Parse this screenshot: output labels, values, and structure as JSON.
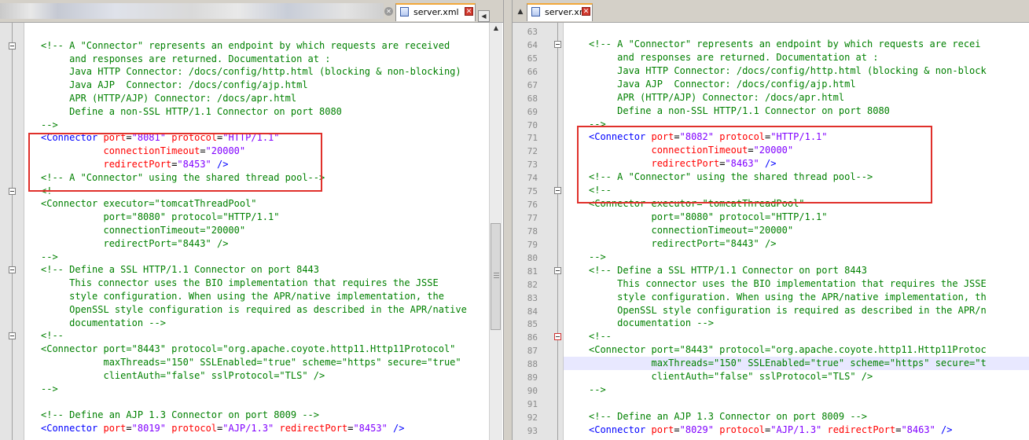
{
  "left_pane": {
    "tab_label": "server.xml",
    "tab_close": "✕",
    "nav_prev": "◀",
    "nav_next": "▶",
    "code": [
      {
        "parts": [
          [
            "c",
            ""
          ]
        ]
      },
      {
        "parts": [
          [
            "c",
            "<!-- A \"Connector\" represents an endpoint by which requests are received"
          ]
        ],
        "fold": true
      },
      {
        "parts": [
          [
            "c",
            "     and responses are returned. Documentation at :"
          ]
        ]
      },
      {
        "parts": [
          [
            "c",
            "     Java HTTP Connector: /docs/config/http.html (blocking & non-blocking)"
          ]
        ]
      },
      {
        "parts": [
          [
            "c",
            "     Java AJP  Connector: /docs/config/ajp.html"
          ]
        ]
      },
      {
        "parts": [
          [
            "c",
            "     APR (HTTP/AJP) Connector: /docs/apr.html"
          ]
        ]
      },
      {
        "parts": [
          [
            "c",
            "     Define a non-SSL HTTP/1.1 Connector on port 8080"
          ]
        ]
      },
      {
        "parts": [
          [
            "c",
            "-->"
          ]
        ]
      },
      {
        "parts": [
          [
            "t",
            "<Connector "
          ],
          [
            "a",
            "port"
          ],
          [
            "p",
            "="
          ],
          [
            "v",
            "\"8081\""
          ],
          [
            "p",
            " "
          ],
          [
            "a",
            "protocol"
          ],
          [
            "p",
            "="
          ],
          [
            "v",
            "\"HTTP/1.1\""
          ]
        ]
      },
      {
        "parts": [
          [
            "p",
            "           "
          ],
          [
            "a",
            "connectionTimeout"
          ],
          [
            "p",
            "="
          ],
          [
            "v",
            "\"20000\""
          ]
        ]
      },
      {
        "parts": [
          [
            "p",
            "           "
          ],
          [
            "a",
            "redirectPort"
          ],
          [
            "p",
            "="
          ],
          [
            "v",
            "\"8453\""
          ],
          [
            "t",
            " />"
          ]
        ]
      },
      {
        "parts": [
          [
            "c",
            "<!-- A \"Connector\" using the shared thread pool-->"
          ]
        ]
      },
      {
        "parts": [
          [
            "c",
            "<!--"
          ]
        ],
        "fold": true
      },
      {
        "parts": [
          [
            "c",
            "<Connector executor=\"tomcatThreadPool\""
          ]
        ]
      },
      {
        "parts": [
          [
            "c",
            "           port=\"8080\" protocol=\"HTTP/1.1\""
          ]
        ]
      },
      {
        "parts": [
          [
            "c",
            "           connectionTimeout=\"20000\""
          ]
        ]
      },
      {
        "parts": [
          [
            "c",
            "           redirectPort=\"8443\" />"
          ]
        ]
      },
      {
        "parts": [
          [
            "c",
            "-->"
          ]
        ]
      },
      {
        "parts": [
          [
            "c",
            "<!-- Define a SSL HTTP/1.1 Connector on port 8443"
          ]
        ],
        "fold": true
      },
      {
        "parts": [
          [
            "c",
            "     This connector uses the BIO implementation that requires the JSSE"
          ]
        ]
      },
      {
        "parts": [
          [
            "c",
            "     style configuration. When using the APR/native implementation, the"
          ]
        ]
      },
      {
        "parts": [
          [
            "c",
            "     OpenSSL style configuration is required as described in the APR/native"
          ]
        ]
      },
      {
        "parts": [
          [
            "c",
            "     documentation -->"
          ]
        ]
      },
      {
        "parts": [
          [
            "c",
            "<!--"
          ]
        ],
        "fold": true
      },
      {
        "parts": [
          [
            "c",
            "<Connector port=\"8443\" protocol=\"org.apache.coyote.http11.Http11Protocol\""
          ]
        ]
      },
      {
        "parts": [
          [
            "c",
            "           maxThreads=\"150\" SSLEnabled=\"true\" scheme=\"https\" secure=\"true\""
          ]
        ]
      },
      {
        "parts": [
          [
            "c",
            "           clientAuth=\"false\" sslProtocol=\"TLS\" />"
          ]
        ]
      },
      {
        "parts": [
          [
            "c",
            "-->"
          ]
        ]
      },
      {
        "parts": [
          [
            "c",
            ""
          ]
        ]
      },
      {
        "parts": [
          [
            "c",
            "<!-- Define an AJP 1.3 Connector on port 8009 -->"
          ]
        ]
      },
      {
        "parts": [
          [
            "t",
            "<Connector "
          ],
          [
            "a",
            "port"
          ],
          [
            "p",
            "="
          ],
          [
            "v",
            "\"8019\""
          ],
          [
            "p",
            " "
          ],
          [
            "a",
            "protocol"
          ],
          [
            "p",
            "="
          ],
          [
            "v",
            "\"AJP/1.3\""
          ],
          [
            "p",
            " "
          ],
          [
            "a",
            "redirectPort"
          ],
          [
            "p",
            "="
          ],
          [
            "v",
            "\"8453\""
          ],
          [
            "t",
            " />"
          ]
        ]
      }
    ]
  },
  "right_pane": {
    "tab_label": "server.xml",
    "tab_close": "✕",
    "lines": [
      {
        "num": "63",
        "parts": [
          [
            "c",
            ""
          ]
        ]
      },
      {
        "num": "64",
        "parts": [
          [
            "c",
            "<!-- A \"Connector\" represents an endpoint by which requests are recei"
          ]
        ],
        "fold": true
      },
      {
        "num": "65",
        "parts": [
          [
            "c",
            "     and responses are returned. Documentation at :"
          ]
        ]
      },
      {
        "num": "66",
        "parts": [
          [
            "c",
            "     Java HTTP Connector: /docs/config/http.html (blocking & non-block"
          ]
        ]
      },
      {
        "num": "67",
        "parts": [
          [
            "c",
            "     Java AJP  Connector: /docs/config/ajp.html"
          ]
        ]
      },
      {
        "num": "68",
        "parts": [
          [
            "c",
            "     APR (HTTP/AJP) Connector: /docs/apr.html"
          ]
        ]
      },
      {
        "num": "69",
        "parts": [
          [
            "c",
            "     Define a non-SSL HTTP/1.1 Connector on port 8080"
          ]
        ]
      },
      {
        "num": "70",
        "parts": [
          [
            "c",
            "-->"
          ]
        ]
      },
      {
        "num": "71",
        "parts": [
          [
            "t",
            "<Connector "
          ],
          [
            "a",
            "port"
          ],
          [
            "p",
            "="
          ],
          [
            "v",
            "\"8082\""
          ],
          [
            "p",
            " "
          ],
          [
            "a",
            "protocol"
          ],
          [
            "p",
            "="
          ],
          [
            "v",
            "\"HTTP/1.1\""
          ]
        ]
      },
      {
        "num": "72",
        "parts": [
          [
            "p",
            "           "
          ],
          [
            "a",
            "connectionTimeout"
          ],
          [
            "p",
            "="
          ],
          [
            "v",
            "\"20000\""
          ]
        ]
      },
      {
        "num": "73",
        "parts": [
          [
            "p",
            "           "
          ],
          [
            "a",
            "redirectPort"
          ],
          [
            "p",
            "="
          ],
          [
            "v",
            "\"8463\""
          ],
          [
            "t",
            " />"
          ]
        ]
      },
      {
        "num": "74",
        "parts": [
          [
            "c",
            "<!-- A \"Connector\" using the shared thread pool-->"
          ]
        ]
      },
      {
        "num": "75",
        "parts": [
          [
            "c",
            "<!--"
          ]
        ],
        "fold": true
      },
      {
        "num": "76",
        "parts": [
          [
            "c",
            "<Connector executor=\"tomcatThreadPool\""
          ]
        ]
      },
      {
        "num": "77",
        "parts": [
          [
            "c",
            "           port=\"8080\" protocol=\"HTTP/1.1\""
          ]
        ]
      },
      {
        "num": "78",
        "parts": [
          [
            "c",
            "           connectionTimeout=\"20000\""
          ]
        ]
      },
      {
        "num": "79",
        "parts": [
          [
            "c",
            "           redirectPort=\"8443\" />"
          ]
        ]
      },
      {
        "num": "80",
        "parts": [
          [
            "c",
            "-->"
          ]
        ]
      },
      {
        "num": "81",
        "parts": [
          [
            "c",
            "<!-- Define a SSL HTTP/1.1 Connector on port 8443"
          ]
        ],
        "fold": true
      },
      {
        "num": "82",
        "parts": [
          [
            "c",
            "     This connector uses the BIO implementation that requires the JSSE"
          ]
        ]
      },
      {
        "num": "83",
        "parts": [
          [
            "c",
            "     style configuration. When using the APR/native implementation, th"
          ]
        ]
      },
      {
        "num": "84",
        "parts": [
          [
            "c",
            "     OpenSSL style configuration is required as described in the APR/n"
          ]
        ]
      },
      {
        "num": "85",
        "parts": [
          [
            "c",
            "     documentation -->"
          ]
        ]
      },
      {
        "num": "86",
        "parts": [
          [
            "c",
            "<!--"
          ]
        ],
        "fold": true,
        "fold_red": true
      },
      {
        "num": "87",
        "parts": [
          [
            "c",
            "<Connector port=\"8443\" protocol=\"org.apache.coyote.http11.Http11Protoc"
          ]
        ]
      },
      {
        "num": "88",
        "parts": [
          [
            "c",
            "           maxThreads=\"150\" SSLEnabled=\"true\" scheme=\"https\" secure=\"t"
          ]
        ],
        "highlight": true
      },
      {
        "num": "89",
        "parts": [
          [
            "c",
            "           clientAuth=\"false\" sslProtocol=\"TLS\" />"
          ]
        ]
      },
      {
        "num": "90",
        "parts": [
          [
            "c",
            "-->"
          ]
        ]
      },
      {
        "num": "91",
        "parts": [
          [
            "c",
            ""
          ]
        ]
      },
      {
        "num": "92",
        "parts": [
          [
            "c",
            "<!-- Define an AJP 1.3 Connector on port 8009 -->"
          ]
        ]
      },
      {
        "num": "93",
        "parts": [
          [
            "t",
            "<Connector "
          ],
          [
            "a",
            "port"
          ],
          [
            "p",
            "="
          ],
          [
            "v",
            "\"8029\""
          ],
          [
            "p",
            " "
          ],
          [
            "a",
            "protocol"
          ],
          [
            "p",
            "="
          ],
          [
            "v",
            "\"AJP/1.3\""
          ],
          [
            "p",
            " "
          ],
          [
            "a",
            "redirectPort"
          ],
          [
            "p",
            "="
          ],
          [
            "v",
            "\"8463\""
          ],
          [
            "t",
            " />"
          ]
        ]
      }
    ]
  },
  "colors": {
    "comment": "#008000",
    "tag": "#0000ff",
    "attribute": "#ff0000",
    "value": "#8000ff",
    "annotation_box": "#e0302b",
    "current_line": "#e8e8ff",
    "tab_accent": "#f2a83a"
  },
  "icons": {
    "file": "xml-file-icon",
    "close": "close-icon",
    "fold": "fold-minus-icon",
    "scroll_up": "scroll-up-icon"
  }
}
